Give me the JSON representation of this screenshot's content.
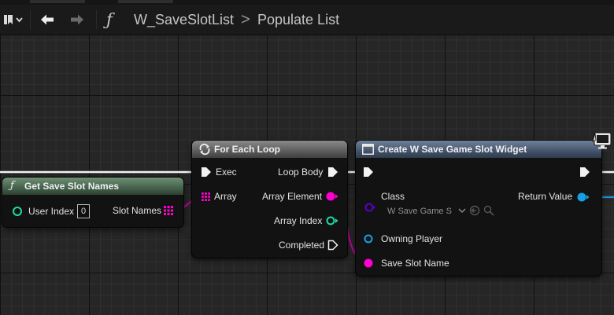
{
  "toolbar": {
    "function_icon": "function-icon",
    "title": "W_SaveSlotList",
    "separator": ">",
    "subtitle": "Populate List"
  },
  "nodes": {
    "get_save_slot_names": {
      "title": "Get Save Slot Names",
      "user_index_label": "User Index",
      "user_index_value": "0",
      "slot_names_label": "Slot Names"
    },
    "for_each_loop": {
      "title": "For Each Loop",
      "exec_label": "Exec",
      "array_label": "Array",
      "loop_body_label": "Loop Body",
      "array_element_label": "Array Element",
      "array_index_label": "Array Index",
      "completed_label": "Completed"
    },
    "create_widget": {
      "title": "Create W Save Game Slot Widget",
      "class_label": "Class",
      "class_value": "W Save Game S",
      "return_value_label": "Return Value",
      "owning_player_label": "Owning Player",
      "save_slot_name_label": "Save Slot Name"
    }
  },
  "colors": {
    "exec_pin": "#ffffff",
    "string_pin": "#ff00d0",
    "integer_pin": "#1ddba8",
    "object_pin": "#18a0e6",
    "class_pin": "#5a00c8",
    "pure_function_header": "#3e5a45",
    "macro_header": "#555555",
    "function_header": "#3d4d63"
  }
}
